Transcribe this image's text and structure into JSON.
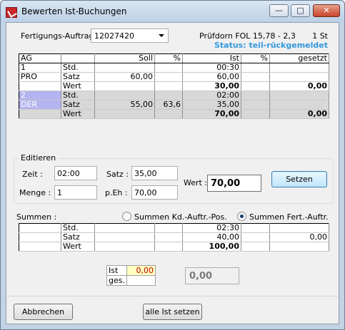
{
  "window": {
    "title": "Bewerten Ist-Buchungen"
  },
  "header": {
    "fa_label": "Fertigungs-Auftrag :",
    "fa_value": "12027420",
    "part": "Prüfdorn FOL 15,78 - 2,3",
    "qty": "1 St",
    "status": "Status: teil-rückgemeldet"
  },
  "grid": {
    "columns": [
      "AG",
      "",
      "Soll",
      "%",
      "Ist",
      "%",
      "gesetzt"
    ],
    "rows": [
      {
        "ag": "1",
        "type": "Std.",
        "soll": "",
        "pct1": "",
        "ist": "00:30",
        "pct2": "",
        "gesetzt": ""
      },
      {
        "ag": "PRO",
        "type": "Satz",
        "soll": "60,00",
        "pct1": "",
        "ist": "60,00",
        "pct2": "",
        "gesetzt": ""
      },
      {
        "ag": "",
        "type": "Wert",
        "soll": "",
        "pct1": "",
        "ist": "30,00",
        "pct2": "",
        "gesetzt": "0,00"
      },
      {
        "ag": "2",
        "type": "Std.",
        "soll": "",
        "pct1": "",
        "ist": "02:00",
        "pct2": "",
        "gesetzt": ""
      },
      {
        "ag": "DER",
        "type": "Satz",
        "soll": "55,00",
        "pct1": "63,6",
        "ist": "35,00",
        "pct2": "",
        "gesetzt": ""
      },
      {
        "ag": "",
        "type": "Wert",
        "soll": "",
        "pct1": "",
        "ist": "70,00",
        "pct2": "",
        "gesetzt": "0,00"
      }
    ]
  },
  "edit": {
    "group_label": "Editieren",
    "zeit_label": "Zeit :",
    "zeit_value": "02:00",
    "satz_label": "Satz :",
    "satz_value": "35,00",
    "menge_label": "Menge :",
    "menge_value": "1",
    "peh_label": "p.Eh :",
    "peh_value": "70,00",
    "wert_label": "Wert :",
    "wert_value": "70,00",
    "setzen_label": "Setzen"
  },
  "summen": {
    "label": "Summen :",
    "radio_kd": "Summen Kd.-Auftr.-Pos.",
    "radio_fert": "Summen Fert.-Auftr.",
    "selected": "fert",
    "rows": [
      {
        "type": "Std.",
        "ist": "02:30",
        "gesetzt": ""
      },
      {
        "type": "Satz",
        "ist": "40,00",
        "gesetzt": "0,00"
      },
      {
        "type": "Wert",
        "ist": "100,00",
        "gesetzt": ""
      }
    ]
  },
  "ist_box": {
    "ist_label": "Ist",
    "ist_value": "0,00",
    "ges_label": "ges.",
    "ges_value": "",
    "total_value": "0,00"
  },
  "footer": {
    "cancel_label": "Abbrechen",
    "all_set_label": "alle Ist setzen"
  }
}
